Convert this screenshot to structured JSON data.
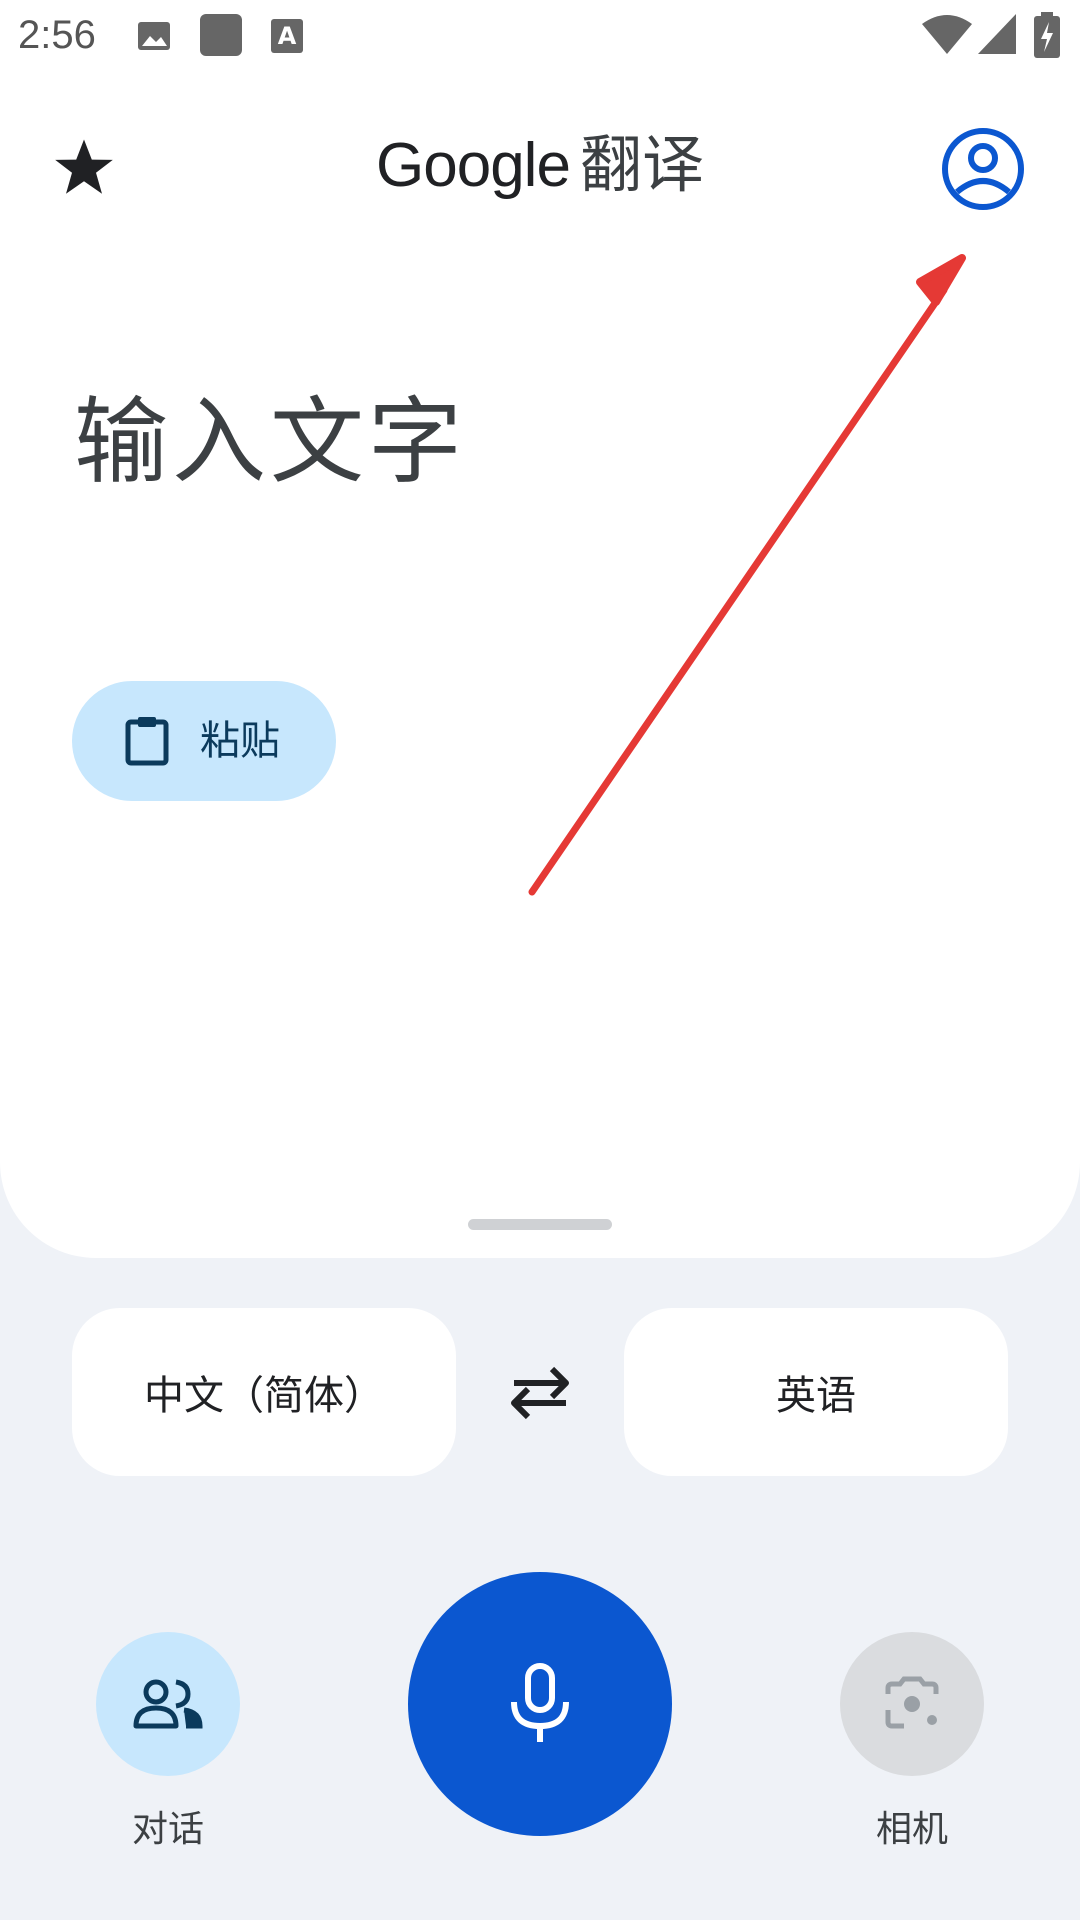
{
  "status_bar": {
    "time": "2:56",
    "icons": [
      "image-icon",
      "square-icon",
      "text-a-icon",
      "wifi-icon",
      "signal-icon",
      "battery-charging-icon"
    ]
  },
  "header": {
    "brand": "Google",
    "product": "翻译",
    "favorites_icon": "star-icon",
    "account_icon": "account-circle-icon"
  },
  "input": {
    "placeholder": "输入文字",
    "paste_label": "粘贴"
  },
  "languages": {
    "source": "中文（简体）",
    "target": "英语",
    "swap_icon": "swap-arrows-icon"
  },
  "bottom": {
    "conversation_label": "对话",
    "camera_label": "相机"
  },
  "colors": {
    "accent_blue": "#0b57d0",
    "light_blue_chip": "#c7e7fd",
    "annotation_red": "#e53935",
    "background": "#eff2f7"
  }
}
